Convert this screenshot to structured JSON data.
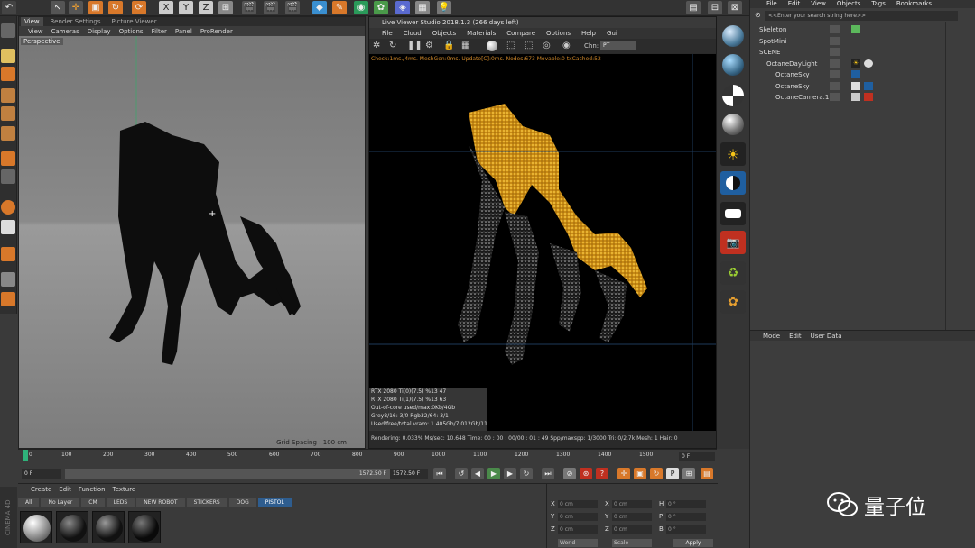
{
  "left_viewport": {
    "tabs": [
      "View",
      "Render Settings",
      "Picture Viewer"
    ],
    "menu": [
      "View",
      "Cameras",
      "Display",
      "Options",
      "Filter",
      "Panel",
      "ProRender"
    ],
    "camera_label": "Perspective",
    "grid_spacing": "Grid Spacing : 100 cm"
  },
  "live_viewer": {
    "title": "Live Viewer Studio 2018.1.3 (266 days left)",
    "menu": [
      "File",
      "Cloud",
      "Objects",
      "Materials",
      "Compare",
      "Options",
      "Help",
      "Gui"
    ],
    "channel_label": "Chn:",
    "channel_value": "PT",
    "stats": "Check:1ms./4ms. MeshGen:0ms. Update[C]:0ms. Nodes:673 Movable:0 txCached:52",
    "gpu_rows": [
      "RTX 2080 Ti(0)(7.5)        %13   47",
      "RTX 2080 Ti(1)(7.5)        %13   63",
      "Out-of-core used/max:0Kb/4Gb",
      "Grey8/16: 3/0            Rgb32/64: 3/1",
      "Used/free/total vram: 1.405Gb/7.012Gb/11Gb   Main: Daldar"
    ],
    "status": "Rendering: 0.033%   Ms/sec: 10.648   Time: 00 : 00 : 00/00 : 01 : 49   Spp/maxspp: 1/3000   Tri: 0/2.7k   Mesh: 1   Hair: 0"
  },
  "object_manager": {
    "menu": [
      "File",
      "Edit",
      "View",
      "Objects",
      "Tags",
      "Bookmarks"
    ],
    "search_placeholder": "<<Enter your search string here>>",
    "objects": [
      "Skeleton",
      "SpotMini",
      "SCENE",
      "OctaneDayLight",
      "OctaneSky",
      "OctaneSky",
      "OctaneCamera.1"
    ]
  },
  "attribute_manager": {
    "menu": [
      "Mode",
      "Edit",
      "User Data"
    ]
  },
  "timeline": {
    "ticks": [
      "0",
      "100",
      "200",
      "300",
      "400",
      "500",
      "600",
      "700",
      "800",
      "900",
      "1000",
      "1100",
      "1200",
      "1300",
      "1400",
      "1500"
    ],
    "end_frame": "0 F"
  },
  "transport": {
    "current_frame": "0 F",
    "min_frame": "0 F",
    "preview_max": "1572.50 F",
    "max_frame": "1572.50 F"
  },
  "material_manager": {
    "menu": [
      "Create",
      "Edit",
      "Function",
      "Texture"
    ],
    "layers": [
      "All",
      "No Layer",
      "CM",
      "LEDS",
      "NEW ROBOT",
      "STICKERS",
      "DOG",
      "PISTOL"
    ],
    "active_layer": "PISTOL"
  },
  "coordinates": {
    "axes": [
      "X",
      "Y",
      "Z"
    ],
    "size_axes": [
      "X",
      "Y",
      "Z"
    ],
    "rot_axes": [
      "H",
      "P",
      "B"
    ],
    "zero_cm": "0 cm",
    "zero_deg": "0 °",
    "mode_world": "World",
    "mode_scale": "Scale",
    "apply_label": "Apply"
  },
  "branding": {
    "vertical": "CINEMA 4D",
    "watermark": "量子位"
  },
  "colors": {
    "accent_blue": "#2e5d8f",
    "octane_orange": "#d28a2a",
    "playhead_green": "#2fb27a"
  }
}
